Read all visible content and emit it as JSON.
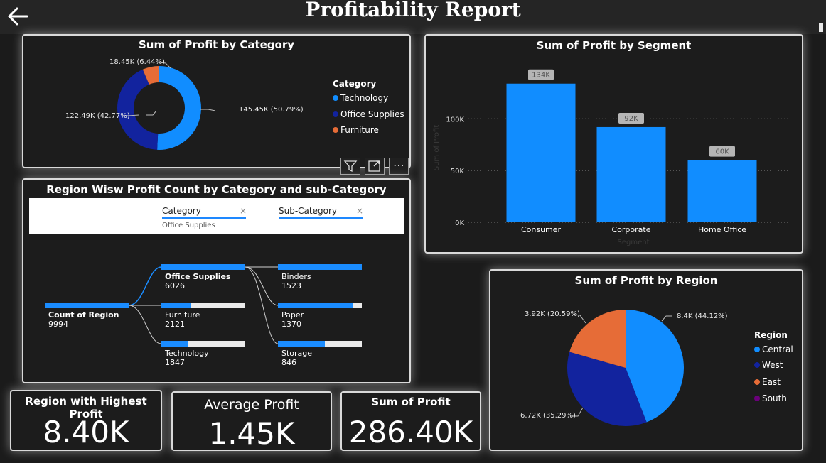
{
  "report": {
    "title": "Profitability Report"
  },
  "category_donut": {
    "title": "Sum of Profit by Category",
    "legend_title": "Category",
    "slices": [
      {
        "name": "Technology",
        "value": 145.45,
        "label": "145.45K (50.79%)",
        "color": "#118dff"
      },
      {
        "name": "Office Supplies",
        "value": 122.49,
        "label": "122.49K (42.77%)",
        "color": "#12239e"
      },
      {
        "name": "Furniture",
        "value": 18.45,
        "label": "18.45K (6.44%)",
        "color": "#e66c37"
      }
    ]
  },
  "segment_chart": {
    "title": "Sum of Profit by Segment",
    "ylabel": "Sum of Profit",
    "xlabel": "Segment",
    "ticks": [
      "100K",
      "50K",
      "0K"
    ],
    "bar_color": "#118dff"
  },
  "chart_data": {
    "type": "bar",
    "title": "Sum of Profit by Segment",
    "categories": [
      "Consumer",
      "Corporate",
      "Home Office"
    ],
    "values": [
      134,
      92,
      60
    ],
    "value_labels": [
      "134K",
      "92K",
      "60K"
    ],
    "xlabel": "Segment",
    "ylabel": "Sum of Profit",
    "ylim": [
      0,
      140
    ],
    "grid": true
  },
  "decomposition": {
    "title": "Region Wisw Profit Count by Category and sub-Category",
    "filters": {
      "category_label": "Category",
      "category_value": "Office Supplies",
      "subcategory_label": "Sub-Category",
      "clear_symbol": "×"
    },
    "root": {
      "name": "Count of Region",
      "value": "9994"
    },
    "level1": [
      {
        "name": "Office Supplies",
        "value": "6026",
        "fraction": 1.0
      },
      {
        "name": "Furniture",
        "value": "2121",
        "fraction": 0.35
      },
      {
        "name": "Technology",
        "value": "1847",
        "fraction": 0.31
      }
    ],
    "level2": [
      {
        "name": "Binders",
        "value": "1523",
        "fraction": 1.0
      },
      {
        "name": "Paper",
        "value": "1370",
        "fraction": 0.9
      },
      {
        "name": "Storage",
        "value": "846",
        "fraction": 0.56
      }
    ]
  },
  "region_pie": {
    "title": "Sum of Profit by Region",
    "legend_title": "Region",
    "legend": [
      {
        "name": "Central",
        "color": "#118dff"
      },
      {
        "name": "West",
        "color": "#12239e"
      },
      {
        "name": "East",
        "color": "#e66c37"
      },
      {
        "name": "South",
        "color": "#6b007b"
      }
    ],
    "slices": [
      {
        "name": "Central",
        "value": 8.4,
        "label": "8.4K (44.12%)",
        "color": "#118dff"
      },
      {
        "name": "West",
        "value": 6.72,
        "label": "6.72K (35.29%)",
        "color": "#12239e"
      },
      {
        "name": "East",
        "value": 3.92,
        "label": "3.92K (20.59%)",
        "color": "#e66c37"
      }
    ]
  },
  "kpis": {
    "highest_region": {
      "title": "Region with Highest Profit",
      "value": "8.40K"
    },
    "average_profit": {
      "title": "Average Profit",
      "value": "1.45K"
    },
    "sum_profit": {
      "title": "Sum of Profit",
      "value": "286.40K"
    }
  },
  "toolbar": {
    "more_symbol": "⋯"
  }
}
